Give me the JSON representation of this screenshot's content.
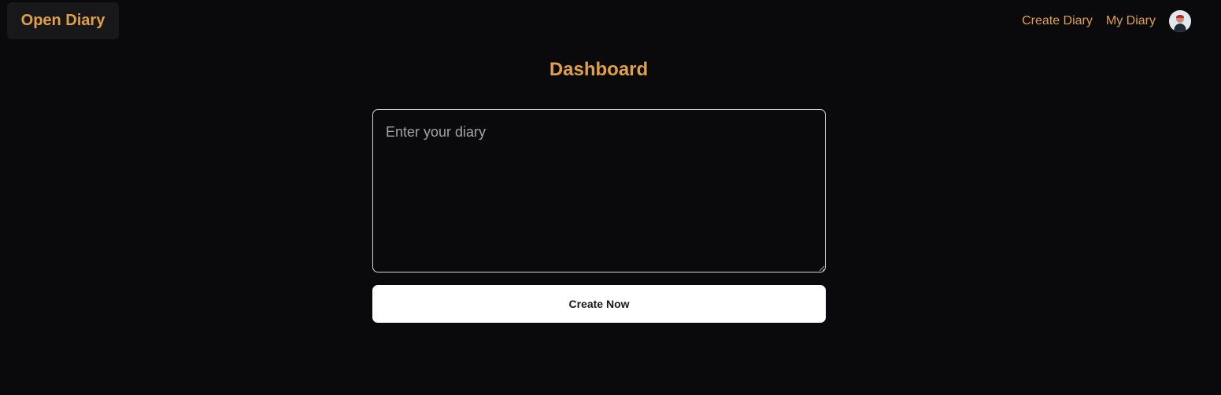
{
  "navbar": {
    "brand": "Open Diary",
    "links": [
      {
        "label": "Create Diary"
      },
      {
        "label": "My Diary"
      }
    ],
    "avatar_icon": "user-avatar-icon"
  },
  "main": {
    "title": "Dashboard",
    "diary_input": {
      "placeholder": "Enter your diary",
      "value": ""
    },
    "create_button": "Create Now"
  },
  "colors": {
    "background": "#0a0a0c",
    "accent": "#e0a045",
    "brand_bg": "#18181b",
    "button_bg": "#ffffff"
  }
}
